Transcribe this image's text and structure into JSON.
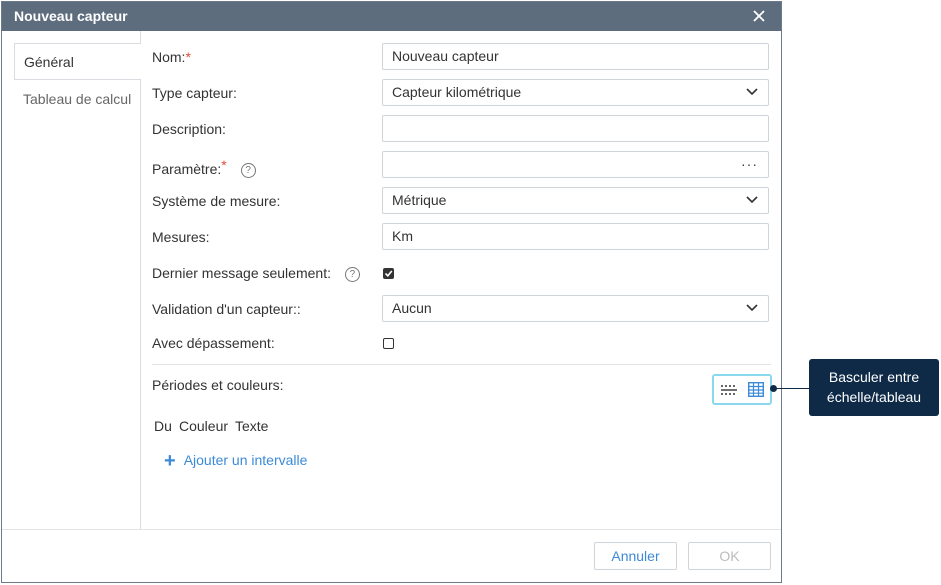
{
  "dialog": {
    "title": "Nouveau capteur"
  },
  "tabs": [
    {
      "label": "Général",
      "active": true
    },
    {
      "label": "Tableau de calcul",
      "active": false
    }
  ],
  "form": {
    "name_label": "Nom:",
    "name_value": "Nouveau capteur",
    "type_label": "Type capteur:",
    "type_value": "Capteur kilométrique",
    "description_label": "Description:",
    "description_value": "",
    "parameter_label": "Paramètre:",
    "parameter_value": "",
    "parameter_button": "···",
    "measure_system_label": "Système de mesure:",
    "measure_system_value": "Métrique",
    "units_label": "Mesures:",
    "units_value": "Km",
    "last_message_label": "Dernier message seulement:",
    "last_message_checked": true,
    "validation_label": "Validation d'un capteur::",
    "validation_value": "Aucun",
    "overflow_label": "Avec dépassement:",
    "overflow_checked": false,
    "required_mark": "*",
    "help_mark": "?"
  },
  "periods": {
    "label": "Périodes et couleurs:",
    "columns": [
      "Du",
      "Couleur",
      "Texte"
    ],
    "add_interval": "Ajouter un intervalle"
  },
  "footer": {
    "cancel_label": "Annuler",
    "ok_label": "OK"
  },
  "callout": {
    "line1": "Basculer entre",
    "line2": "échelle/tableau"
  },
  "colors": {
    "titlebar": "#5d6d7e",
    "accent": "#3c8ad8",
    "required": "#e24c3a",
    "callout": "#0e2a47",
    "toggle_border": "#8ad8ee"
  },
  "icons": {
    "close": "close-icon",
    "dropdown": "chevron-down-icon",
    "help": "help-circle-icon",
    "scale_view": "scale-view-icon",
    "table_view": "table-view-icon",
    "add": "plus-icon"
  }
}
